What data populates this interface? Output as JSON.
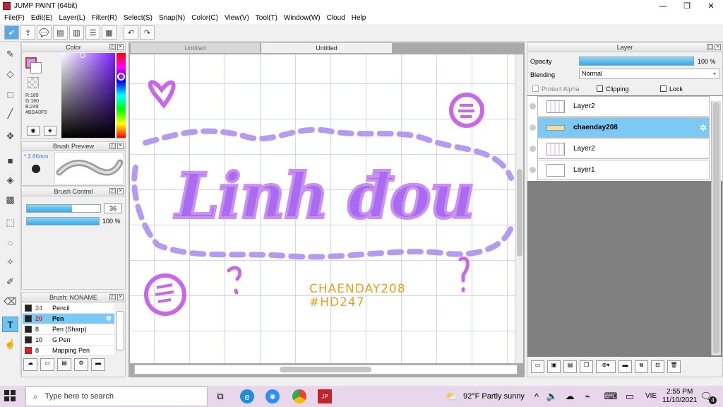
{
  "window": {
    "title": "JUMP PAINT (64bit)"
  },
  "menu": [
    "File(F)",
    "Edit(E)",
    "Layer(L)",
    "Filter(R)",
    "Select(S)",
    "Snap(N)",
    "Color(C)",
    "View(V)",
    "Tool(T)",
    "Window(W)",
    "Cloud",
    "Help"
  ],
  "color_panel": {
    "title": "Color",
    "r": "R:189",
    "g": "G:160",
    "b": "B:249",
    "hex": "#BDA0F9",
    "fg_color": "#bda0f9"
  },
  "brush_preview": {
    "title": "Brush Preview",
    "size": "* 2.66mm"
  },
  "brush_control": {
    "title": "Brush Control",
    "size_value": "36",
    "size_fill": 0.62,
    "opacity_value": "100 %",
    "opacity_fill": 1.0
  },
  "brush_list": {
    "title": "Brush: NONAME",
    "items": [
      {
        "size": "24",
        "name": "Pencil",
        "color": "#222222"
      },
      {
        "size": "20",
        "name": "Pen",
        "color": "#222222"
      },
      {
        "size": "8",
        "name": "Pen (Sharp)",
        "color": "#222222"
      },
      {
        "size": "10",
        "name": "G Pen",
        "color": "#222222"
      },
      {
        "size": "8",
        "name": "Mapping Pen",
        "color": "#e02020"
      }
    ]
  },
  "canvas": {
    "tabs": [
      "Untitled",
      "Untitled"
    ],
    "lettering": "Linh đou",
    "credit_1": "CHAENDAY208",
    "credit_2": "#HD247"
  },
  "layer_panel": {
    "title": "Layer",
    "opacity_label": "Opacity",
    "opacity_value": "100 %",
    "blending_label": "Blending",
    "blending_value": "Normal",
    "protect_alpha": "Protect Alpha",
    "clipping": "Clipping",
    "lock": "Lock",
    "layers": [
      {
        "name": "Layer2"
      },
      {
        "name": "chaenday208"
      },
      {
        "name": "Layer2"
      },
      {
        "name": "Layer1"
      }
    ]
  },
  "taskbar": {
    "search_placeholder": "Type here to search",
    "weather": "92°F  Partly sunny",
    "lang": "VIE",
    "time": "2:55 PM",
    "date": "11/10/2021",
    "notif_count": "4"
  },
  "colors": {
    "accent": "#7cc9f3",
    "lettering": "#a96cf0",
    "credit": "#e0a31e",
    "taskbar": "#e8d7ea"
  }
}
